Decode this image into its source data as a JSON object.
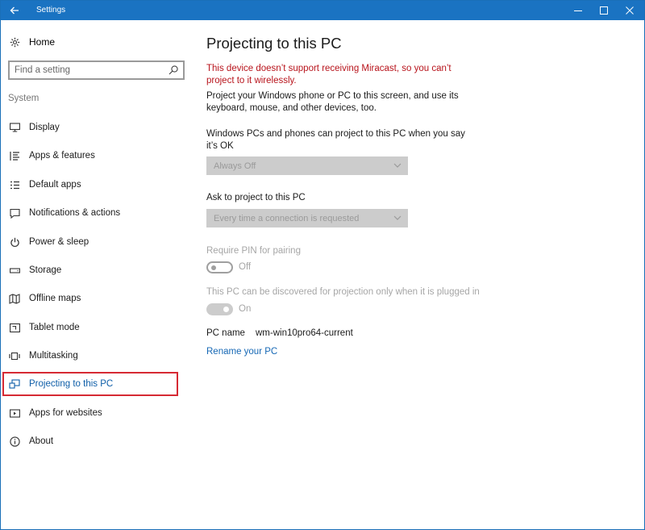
{
  "window": {
    "title": "Settings"
  },
  "sidebar": {
    "home_label": "Home",
    "search_placeholder": "Find a setting",
    "section_label": "System",
    "items": [
      {
        "label": "Display"
      },
      {
        "label": "Apps & features"
      },
      {
        "label": "Default apps"
      },
      {
        "label": "Notifications & actions"
      },
      {
        "label": "Power & sleep"
      },
      {
        "label": "Storage"
      },
      {
        "label": "Offline maps"
      },
      {
        "label": "Tablet mode"
      },
      {
        "label": "Multitasking"
      },
      {
        "label": "Projecting to this PC"
      },
      {
        "label": "Apps for websites"
      },
      {
        "label": "About"
      }
    ],
    "selected_index": 9
  },
  "main": {
    "title": "Projecting to this PC",
    "warning": "This device doesn’t support receiving Miracast, so you can’t project to it wirelessly.",
    "description": "Project your Windows phone or PC to this screen, and use its keyboard, mouse, and other devices, too.",
    "project_label": "Windows PCs and phones can project to this PC when you say it’s OK",
    "project_value": "Always Off",
    "ask_label": "Ask to project to this PC",
    "ask_value": "Every time a connection is requested",
    "pin_label": "Require PIN for pairing",
    "pin_state": "Off",
    "plugged_label": "This PC can be discovered for projection only when it is plugged in",
    "plugged_state": "On",
    "pc_name_label": "PC name",
    "pc_name_value": "wm-win10pro64-current",
    "rename_link": "Rename your PC"
  },
  "colors": {
    "titlebar": "#1a73c2",
    "warning": "#b8141c",
    "link": "#1668b5",
    "selection_border": "#d62a34"
  }
}
